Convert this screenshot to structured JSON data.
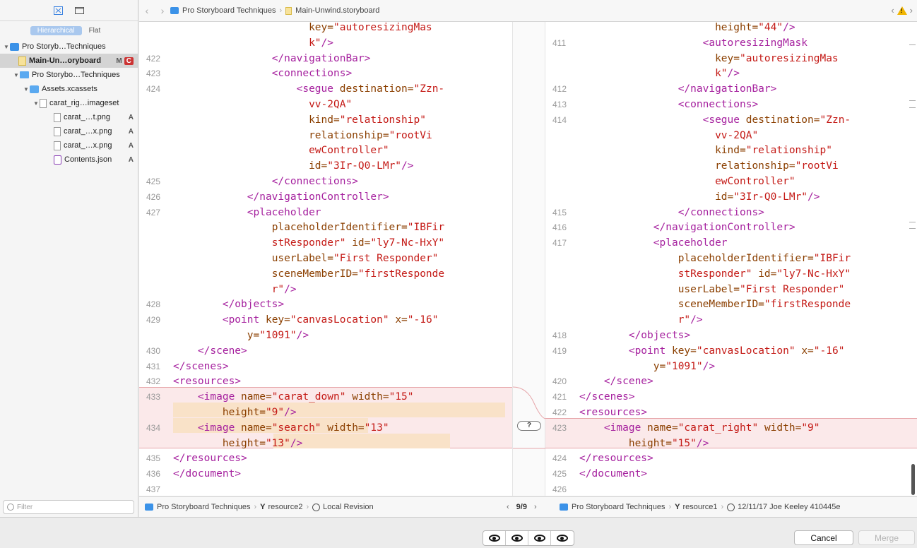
{
  "sidebar": {
    "segments": [
      "Hierarchical",
      "Flat"
    ],
    "tree": [
      {
        "label": "Pro Storyb…Techniques",
        "badge": "",
        "badge2": ""
      },
      {
        "label": "Main-Un…oryboard",
        "badge": "M",
        "badge2": "C"
      },
      {
        "label": "Pro Storybo…Techniques",
        "badge": "",
        "badge2": ""
      },
      {
        "label": "Assets.xcassets",
        "badge": "",
        "badge2": ""
      },
      {
        "label": "carat_rig…imageset",
        "badge": "",
        "badge2": ""
      },
      {
        "label": "carat_…t.png",
        "badge": "A",
        "badge2": ""
      },
      {
        "label": "carat_…x.png",
        "badge": "A",
        "badge2": ""
      },
      {
        "label": "carat_…x.png",
        "badge": "A",
        "badge2": ""
      },
      {
        "label": "Contents.json",
        "badge": "A",
        "badge2": ""
      }
    ],
    "filter_placeholder": "Filter"
  },
  "pathbar": {
    "project": "Pro Storyboard Techniques",
    "file": "Main-Unwind.storyboard"
  },
  "left_lines": [
    {
      "n": "",
      "html": "                      <span class='attr'>key=</span><span class='str'>\"autoresizingMas</span>"
    },
    {
      "n": "",
      "html": "                      <span class='str'>k\"</span><span class='tag'>/></span>"
    },
    {
      "n": "422",
      "html": "                <span class='tag'>&lt;/navigationBar&gt;</span>"
    },
    {
      "n": "423",
      "html": "                <span class='tag'>&lt;connections&gt;</span>"
    },
    {
      "n": "424",
      "html": "                    <span class='tag'>&lt;segue</span> <span class='attr'>destination=</span><span class='str'>\"Zzn-</span>"
    },
    {
      "n": "",
      "html": "                      <span class='str'>vv-2QA\"</span>"
    },
    {
      "n": "",
      "html": "                      <span class='attr'>kind=</span><span class='str'>\"relationship\"</span>"
    },
    {
      "n": "",
      "html": "                      <span class='attr'>relationship=</span><span class='str'>\"rootVi</span>"
    },
    {
      "n": "",
      "html": "                      <span class='str'>ewController\"</span>"
    },
    {
      "n": "",
      "html": "                      <span class='attr'>id=</span><span class='str'>\"3Ir-Q0-LMr\"</span><span class='tag'>/></span>"
    },
    {
      "n": "425",
      "html": "                <span class='tag'>&lt;/connections&gt;</span>"
    },
    {
      "n": "426",
      "html": "            <span class='tag'>&lt;/navigationController&gt;</span>"
    },
    {
      "n": "427",
      "html": "            <span class='tag'>&lt;placeholder</span>"
    },
    {
      "n": "",
      "html": "                <span class='attr'>placeholderIdentifier=</span><span class='str'>\"IBFir</span>"
    },
    {
      "n": "",
      "html": "                <span class='str'>stResponder\"</span> <span class='attr'>id=</span><span class='str'>\"ly7-Nc-HxY\"</span>"
    },
    {
      "n": "",
      "html": "                <span class='attr'>userLabel=</span><span class='str'>\"First Responder\"</span>"
    },
    {
      "n": "",
      "html": "                <span class='attr'>sceneMemberID=</span><span class='str'>\"firstResponde</span>"
    },
    {
      "n": "",
      "html": "                <span class='str'>r\"</span><span class='tag'>/></span>"
    },
    {
      "n": "428",
      "html": "        <span class='tag'>&lt;/objects&gt;</span>"
    },
    {
      "n": "429",
      "html": "        <span class='tag'>&lt;point</span> <span class='attr'>key=</span><span class='str'>\"canvasLocation\"</span> <span class='attr'>x=</span><span class='str'>\"-16\"</span>"
    },
    {
      "n": "",
      "html": "            <span class='attr'>y=</span><span class='str'>\"1091\"</span><span class='tag'>/></span>"
    },
    {
      "n": "430",
      "html": "    <span class='tag'>&lt;/scene&gt;</span>"
    },
    {
      "n": "431",
      "html": "<span class='tag'>&lt;/scenes&gt;</span>"
    },
    {
      "n": "432",
      "html": "<span class='tag'>&lt;resources&gt;</span>"
    },
    {
      "n": "433",
      "html": "    <span class='tag'>&lt;image</span> <span class='attr'>name=</span><span class='str'>\"carat_down\"</span> <span class='attr'>width=</span><span class='str'>\"15\"</span>"
    },
    {
      "n": "",
      "html": "        <span class='attr'>height=</span><span class='str'>\"9\"</span><span class='tag'>/></span>"
    },
    {
      "n": "434",
      "html": "    <span class='tag'>&lt;image</span> <span class='attr'>name=</span><span class='str'>\"search\"</span> <span class='attr'>width=</span><span class='str'>\"13\"</span>"
    },
    {
      "n": "",
      "html": "        <span class='attr'>height=</span><span class='str'>\"13\"</span><span class='tag'>/></span>"
    },
    {
      "n": "435",
      "html": "<span class='tag'>&lt;/resources&gt;</span>"
    },
    {
      "n": "436",
      "html": "<span class='tag'>&lt;/document&gt;</span>"
    },
    {
      "n": "437",
      "html": ""
    }
  ],
  "right_lines": [
    {
      "n": "",
      "html": "                      <span class='attr'>height=</span><span class='str'>\"44\"</span><span class='tag'>/></span>"
    },
    {
      "n": "411",
      "html": "                    <span class='tag'>&lt;autoresizingMask</span>"
    },
    {
      "n": "",
      "html": "                      <span class='attr'>key=</span><span class='str'>\"autoresizingMas</span>"
    },
    {
      "n": "",
      "html": "                      <span class='str'>k\"</span><span class='tag'>/></span>"
    },
    {
      "n": "412",
      "html": "                <span class='tag'>&lt;/navigationBar&gt;</span>"
    },
    {
      "n": "413",
      "html": "                <span class='tag'>&lt;connections&gt;</span>"
    },
    {
      "n": "414",
      "html": "                    <span class='tag'>&lt;segue</span> <span class='attr'>destination=</span><span class='str'>\"Zzn-</span>"
    },
    {
      "n": "",
      "html": "                      <span class='str'>vv-2QA\"</span>"
    },
    {
      "n": "",
      "html": "                      <span class='attr'>kind=</span><span class='str'>\"relationship\"</span>"
    },
    {
      "n": "",
      "html": "                      <span class='attr'>relationship=</span><span class='str'>\"rootVi</span>"
    },
    {
      "n": "",
      "html": "                      <span class='str'>ewController\"</span>"
    },
    {
      "n": "",
      "html": "                      <span class='attr'>id=</span><span class='str'>\"3Ir-Q0-LMr\"</span><span class='tag'>/></span>"
    },
    {
      "n": "415",
      "html": "                <span class='tag'>&lt;/connections&gt;</span>"
    },
    {
      "n": "416",
      "html": "            <span class='tag'>&lt;/navigationController&gt;</span>"
    },
    {
      "n": "417",
      "html": "            <span class='tag'>&lt;placeholder</span>"
    },
    {
      "n": "",
      "html": "                <span class='attr'>placeholderIdentifier=</span><span class='str'>\"IBFir</span>"
    },
    {
      "n": "",
      "html": "                <span class='str'>stResponder\"</span> <span class='attr'>id=</span><span class='str'>\"ly7-Nc-HxY\"</span>"
    },
    {
      "n": "",
      "html": "                <span class='attr'>userLabel=</span><span class='str'>\"First Responder\"</span>"
    },
    {
      "n": "",
      "html": "                <span class='attr'>sceneMemberID=</span><span class='str'>\"firstResponde</span>"
    },
    {
      "n": "",
      "html": "                <span class='str'>r\"</span><span class='tag'>/></span>"
    },
    {
      "n": "418",
      "html": "        <span class='tag'>&lt;/objects&gt;</span>"
    },
    {
      "n": "419",
      "html": "        <span class='tag'>&lt;point</span> <span class='attr'>key=</span><span class='str'>\"canvasLocation\"</span> <span class='attr'>x=</span><span class='str'>\"-16\"</span>"
    },
    {
      "n": "",
      "html": "            <span class='attr'>y=</span><span class='str'>\"1091\"</span><span class='tag'>/></span>"
    },
    {
      "n": "420",
      "html": "    <span class='tag'>&lt;/scene&gt;</span>"
    },
    {
      "n": "421",
      "html": "<span class='tag'>&lt;/scenes&gt;</span>"
    },
    {
      "n": "422",
      "html": "<span class='tag'>&lt;resources&gt;</span>"
    },
    {
      "n": "423",
      "html": "    <span class='tag'>&lt;image</span> <span class='attr'>name=</span><span class='str'>\"carat_right\"</span> <span class='attr'>width=</span><span class='str'>\"9\"</span>"
    },
    {
      "n": "",
      "html": "        <span class='attr'>height=</span><span class='str'>\"15\"</span><span class='tag'>/></span>"
    },
    {
      "n": "424",
      "html": "<span class='tag'>&lt;/resources&gt;</span>"
    },
    {
      "n": "425",
      "html": "<span class='tag'>&lt;/document&gt;</span>"
    },
    {
      "n": "426",
      "html": ""
    }
  ],
  "diff_marker": "?",
  "status": {
    "left_project": "Pro Storyboard Techniques",
    "left_branch": "resource2",
    "left_rev": "Local Revision",
    "counter": "9/9",
    "right_project": "Pro Storyboard Techniques",
    "right_branch": "resource1",
    "right_rev": "12/11/17  Joe Keeley  410445e"
  },
  "footer": {
    "cancel_label": "Cancel",
    "merge_label": "Merge"
  },
  "colors": {
    "tag": "#a6229f",
    "attribute": "#8b3f00",
    "string": "#c41a16",
    "diff_background": "#fbe9ea",
    "diff_highlight": "#f9e2c8"
  }
}
